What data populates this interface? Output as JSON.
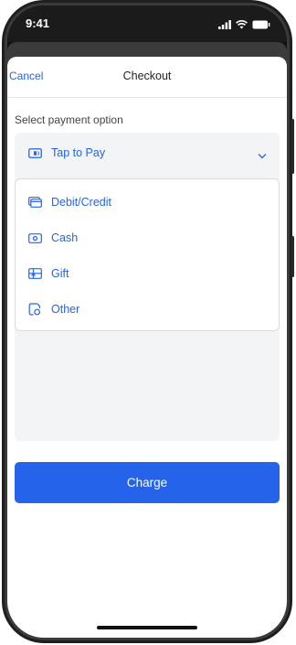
{
  "status_bar": {
    "time": "9:41",
    "icons": [
      "signal-icon",
      "wifi-icon",
      "battery-icon"
    ]
  },
  "nav": {
    "cancel_label": "Cancel",
    "title": "Checkout"
  },
  "payment": {
    "section_label": "Select payment option",
    "selected": {
      "label": "Tap to Pay",
      "icon": "tap-to-pay-icon"
    },
    "options": [
      {
        "label": "Debit/Credit",
        "icon": "card-icon"
      },
      {
        "label": "Cash",
        "icon": "cash-icon"
      },
      {
        "label": "Gift",
        "icon": "gift-card-icon"
      },
      {
        "label": "Other",
        "icon": "other-payment-icon"
      }
    ]
  },
  "charge_button": {
    "label": "Charge"
  },
  "colors": {
    "accent": "#2563eb",
    "panel_bg": "#f3f4f6",
    "frame": "#1e1e1e"
  }
}
